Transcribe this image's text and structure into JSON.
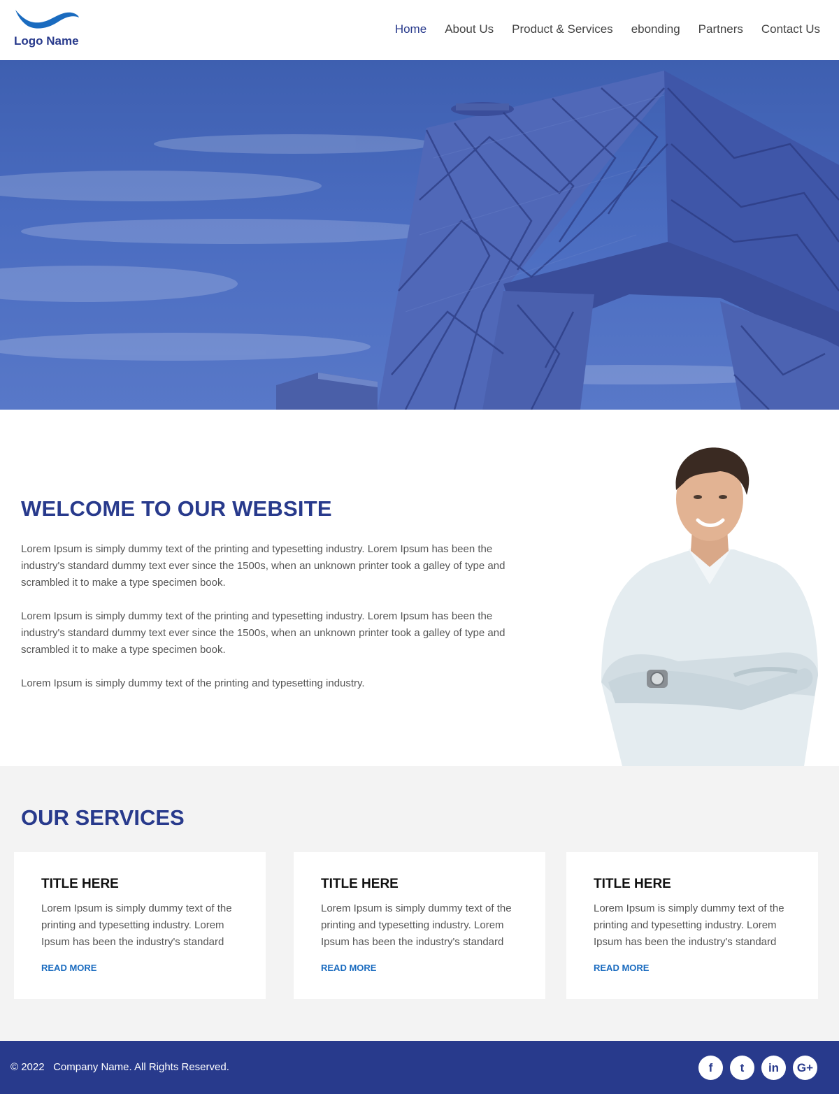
{
  "header": {
    "logo_text": "Logo Name",
    "nav": [
      {
        "label": "Home",
        "active": true
      },
      {
        "label": "About Us",
        "active": false
      },
      {
        "label": "Product & Services",
        "active": false
      },
      {
        "label": "ebonding",
        "active": false
      },
      {
        "label": "Partners",
        "active": false
      },
      {
        "label": "Contact Us",
        "active": false
      }
    ]
  },
  "welcome": {
    "title": "WELCOME TO OUR WEBSITE",
    "paragraphs": [
      "Lorem Ipsum is simply dummy text of the printing and typesetting industry. Lorem Ipsum has been the industry's standard dummy text ever since the 1500s, when an unknown printer took a galley of type and scrambled it to make a type specimen book.",
      "Lorem Ipsum is simply dummy text of the printing and typesetting industry. Lorem Ipsum has been the industry's standard dummy text ever since the 1500s, when an unknown printer took a galley of type and scrambled it to make a type specimen book.",
      "Lorem Ipsum is simply dummy text of the printing and typesetting industry."
    ]
  },
  "services": {
    "title": "OUR SERVICES",
    "cards": [
      {
        "title": "TITLE HERE",
        "text": "Lorem Ipsum is simply dummy text of the printing and typesetting industry. Lorem Ipsum has been the industry's standard",
        "link": "READ MORE"
      },
      {
        "title": "TITLE HERE",
        "text": "Lorem Ipsum is simply dummy text of the printing and typesetting industry. Lorem Ipsum has been the industry's standard",
        "link": "READ MORE"
      },
      {
        "title": "TITLE HERE",
        "text": "Lorem Ipsum is simply dummy text of the printing and typesetting industry. Lorem Ipsum has been the industry's standard",
        "link": "READ MORE"
      }
    ]
  },
  "footer": {
    "copyright": "© 2022   Company Name. All Rights Reserved.",
    "socials": [
      {
        "icon": "facebook-icon",
        "glyph": "f"
      },
      {
        "icon": "twitter-icon",
        "glyph": "t"
      },
      {
        "icon": "linkedin-icon",
        "glyph": "in"
      },
      {
        "icon": "google-plus-icon",
        "glyph": "G+"
      }
    ]
  },
  "colors": {
    "brand": "#283a8c",
    "link": "#1a6bbf",
    "services_bg": "#f3f3f3"
  }
}
